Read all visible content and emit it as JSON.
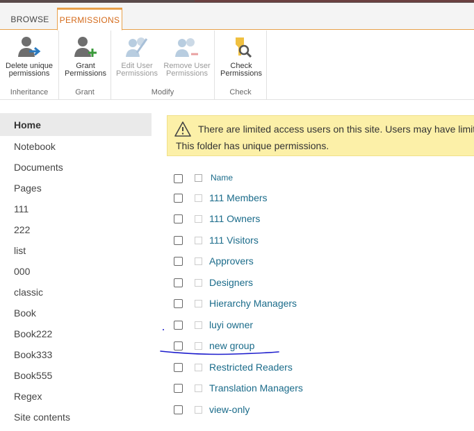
{
  "tabs": {
    "browse": "BROWSE",
    "permissions": "PERMISSIONS"
  },
  "ribbon": {
    "inheritance": {
      "label": "Inheritance",
      "delete_line1": "Delete unique",
      "delete_line2": "permissions"
    },
    "grant": {
      "label": "Grant",
      "grant_line1": "Grant",
      "grant_line2": "Permissions"
    },
    "modify": {
      "label": "Modify",
      "edit_line1": "Edit User",
      "edit_line2": "Permissions",
      "remove_line1": "Remove User",
      "remove_line2": "Permissions"
    },
    "check": {
      "label": "Check",
      "check_line1": "Check",
      "check_line2": "Permissions"
    }
  },
  "nav": [
    "Home",
    "Notebook",
    "Documents",
    "Pages",
    "111",
    "222",
    "list",
    "000",
    "classic",
    "Book",
    "Book222",
    "Book333",
    "Book555",
    "Regex",
    "Site contents"
  ],
  "warning": {
    "line1": "There are limited access users on this site. Users may have limit",
    "line2": "This folder has unique permissions."
  },
  "list": {
    "header_name": "Name",
    "rows": [
      "111 Members",
      "111 Owners",
      "111 Visitors",
      "Approvers",
      "Designers",
      "Hierarchy Managers",
      "luyi owner",
      "new group",
      "Restricted Readers",
      "Translation Managers",
      "view-only"
    ]
  },
  "colors": {
    "accent": "#e8a04a",
    "tab_text": "#d46a1a",
    "link": "#1a6b8a",
    "warning_bg": "#fcf0a8",
    "annotation": "#1a1acc"
  }
}
